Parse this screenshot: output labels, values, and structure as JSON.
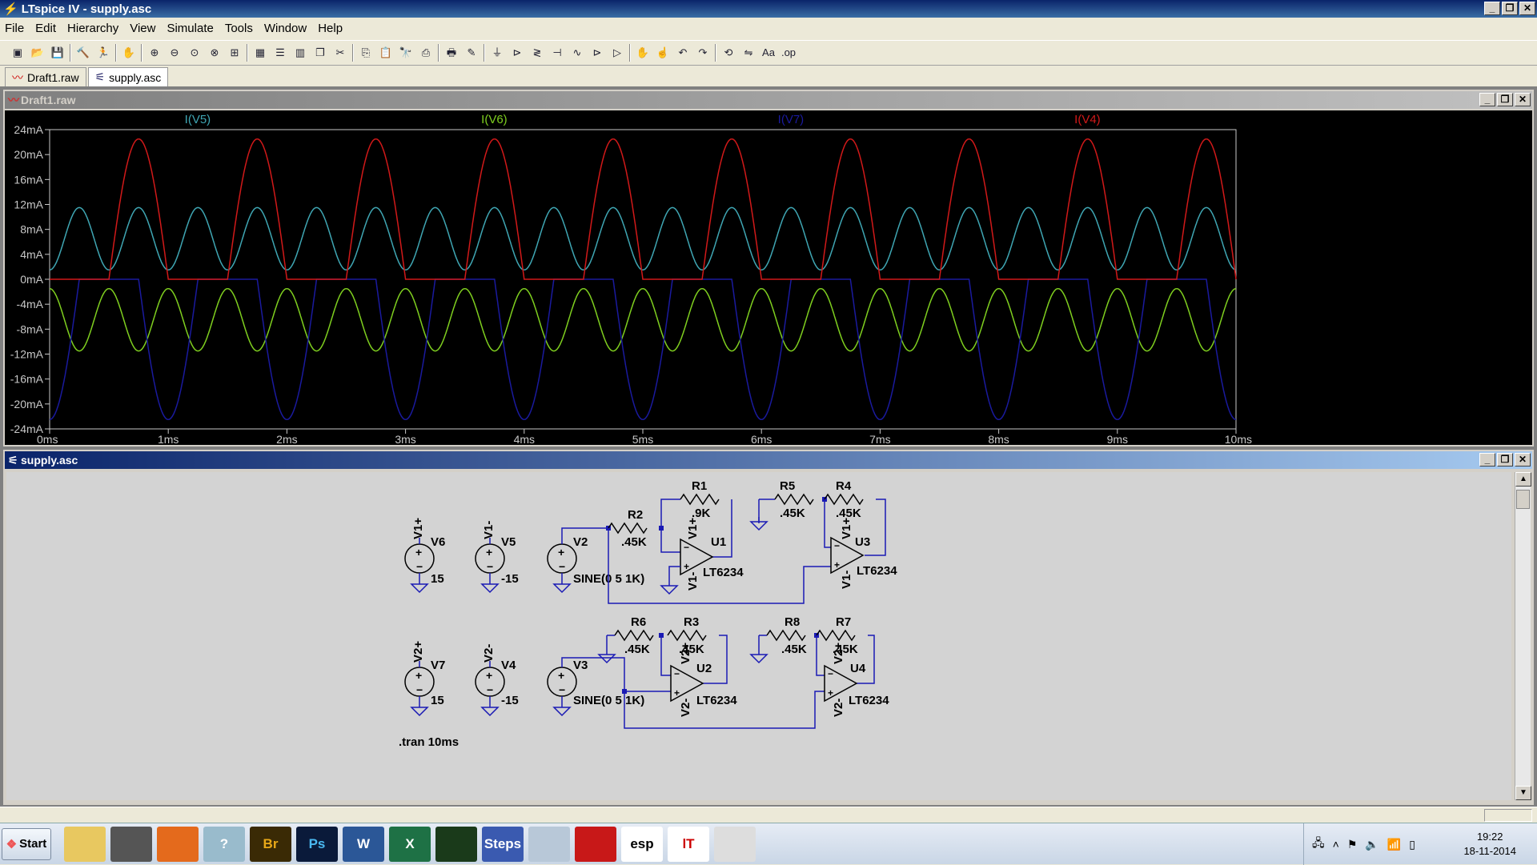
{
  "window": {
    "title": "LTspice IV - supply.asc",
    "controls": [
      "_",
      "❐",
      "✕"
    ]
  },
  "menu": [
    "File",
    "Edit",
    "Hierarchy",
    "View",
    "Simulate",
    "Tools",
    "Window",
    "Help"
  ],
  "toolbar_icons": [
    "new-schematic-icon",
    "open-icon",
    "save-icon",
    "control-panel-icon",
    "run-icon",
    "halt-icon",
    "zoom-in-icon",
    "zoom-out-icon",
    "zoom-fit-icon",
    "zoom-cancel-icon",
    "autoscale-icon",
    "grid-icon",
    "tile-horizontal-icon",
    "tile-vertical-icon",
    "cascade-icon",
    "cut-icon",
    "copy-icon",
    "paste-icon",
    "find-icon",
    "print-setup-icon",
    "print-icon",
    "wire-icon",
    "ground-icon",
    "label-icon",
    "resistor-icon",
    "capacitor-icon",
    "inductor-icon",
    "diode-icon",
    "component-icon",
    "move-icon",
    "drag-icon",
    "undo-icon",
    "redo-icon",
    "rotate-icon",
    "mirror-icon",
    "text-icon",
    "spice-directive-icon"
  ],
  "tabs": [
    {
      "label": "Draft1.raw",
      "icon": "waveform-icon"
    },
    {
      "label": "supply.asc",
      "icon": "schematic-icon"
    }
  ],
  "plot_window": {
    "title": "Draft1.raw"
  },
  "schematic_window": {
    "title": "supply.asc"
  },
  "chart_data": {
    "type": "line",
    "title": "",
    "xlabel": "",
    "ylabel": "",
    "xlim": [
      0,
      10
    ],
    "ylim": [
      -24,
      24
    ],
    "x_unit": "ms",
    "y_unit": "mA",
    "xticks": [
      "0ms",
      "1ms",
      "2ms",
      "3ms",
      "4ms",
      "5ms",
      "6ms",
      "7ms",
      "8ms",
      "9ms",
      "10ms"
    ],
    "yticks": [
      "24mA",
      "20mA",
      "16mA",
      "12mA",
      "8mA",
      "4mA",
      "0mA",
      "-4mA",
      "-8mA",
      "-12mA",
      "-16mA",
      "-20mA",
      "-24mA"
    ],
    "grid": false,
    "background": "#000000",
    "frequency_khz": 1,
    "series": [
      {
        "name": "I(V5)",
        "color": "#3fa6b3",
        "description": "sinusoid 2 kHz between 1.5 and 11.5 mA",
        "offset": 6.5,
        "amplitude": 5,
        "freq_khz": 2,
        "min_ma": 1.5,
        "max_ma": 11.5
      },
      {
        "name": "I(V6)",
        "color": "#7fcf1f",
        "offset": -6.5,
        "amplitude": 5,
        "freq_khz": 2,
        "min_ma": -11.5,
        "max_ma": -1.5
      },
      {
        "name": "I(V7)",
        "color": "#1a1a9e",
        "peak_ma": -22.5,
        "kind": "half-wave negative",
        "freq_khz": 1
      },
      {
        "name": "I(V4)",
        "color": "#d11919",
        "peak_ma": 22.5,
        "kind": "half-wave positive",
        "freq_khz": 1
      }
    ]
  },
  "schematic": {
    "wire_color": "#1a1ab4",
    "labels": {
      "V6": "V6",
      "V6_val": "15",
      "V6_net": "V1+",
      "V5": "V5",
      "V5_val": "-15",
      "V5_net": "V1-",
      "V2": "V2",
      "V2_val": "SINE(0 5 1K)",
      "R2": "R2",
      "R2_val": ".45K",
      "R1": "R1",
      "R1_val": ".9K",
      "U1": "U1",
      "U1_part": "LT6234",
      "U1_top": "V1+",
      "U1_bot": "V1-",
      "R5": "R5",
      "R5_val": ".45K",
      "R4": "R4",
      "R4_val": ".45K",
      "U3": "U3",
      "U3_part": "LT6234",
      "U3_top": "V1+",
      "U3_bot": "V1-",
      "V7": "V7",
      "V7_val": "15",
      "V7_net": "V2+",
      "V4": "V4",
      "V4_val": "-15",
      "V4_net": "V2-",
      "V3": "V3",
      "V3_val": "SINE(0 5 1K)",
      "R6": "R6",
      "R6_val": ".45K",
      "R3": "R3",
      "R3_val": ".45K",
      "U2": "U2",
      "U2_part": "LT6234",
      "U2_top": "V2+",
      "U2_bot": "V2-",
      "R8": "R8",
      "R8_val": ".45K",
      "R7": "R7",
      "R7_val": ".45K",
      "U4": "U4",
      "U4_part": "LT6234",
      "U4_top": "V2+",
      "U4_bot": "V2-",
      "directive": ".tran 10ms"
    }
  },
  "taskbar": {
    "start": "Start",
    "apps": [
      {
        "label": "",
        "icon": "explorer-icon",
        "bg": "#e8c860"
      },
      {
        "label": "",
        "icon": "camera-icon",
        "bg": "#555"
      },
      {
        "label": "",
        "icon": "firefox-icon",
        "bg": "#e46a1c"
      },
      {
        "label": "?",
        "icon": "help-icon",
        "bg": "#9bc"
      },
      {
        "label": "Br",
        "icon": "bridge-icon",
        "bg": "#3a2a05",
        "fg": "#e8a818"
      },
      {
        "label": "Ps",
        "icon": "photoshop-icon",
        "bg": "#0a1a3a",
        "fg": "#4ab8f0"
      },
      {
        "label": "W",
        "icon": "word-icon",
        "bg": "#2b5797",
        "fg": "#fff"
      },
      {
        "label": "X",
        "icon": "excel-icon",
        "bg": "#1e7145",
        "fg": "#fff"
      },
      {
        "label": "",
        "icon": "oscilloscope-icon",
        "bg": "#1a3a1a"
      },
      {
        "label": "Steps",
        "icon": "steps-icon",
        "bg": "#3a5ab0",
        "fg": "#fff"
      },
      {
        "label": "",
        "icon": "calculator-icon",
        "bg": "#b8c8d8"
      },
      {
        "label": "",
        "icon": "ccleaner-icon",
        "bg": "#c81818"
      },
      {
        "label": "esp",
        "icon": "esp-icon",
        "bg": "#fff",
        "fg": "#000"
      },
      {
        "label": "lT",
        "icon": "ltspice-icon",
        "bg": "#fff",
        "fg": "#c00"
      },
      {
        "label": "",
        "icon": "audio-tool-icon",
        "bg": "#ddd"
      }
    ],
    "clock_time": "19:22",
    "clock_date": "18-11-2014"
  }
}
